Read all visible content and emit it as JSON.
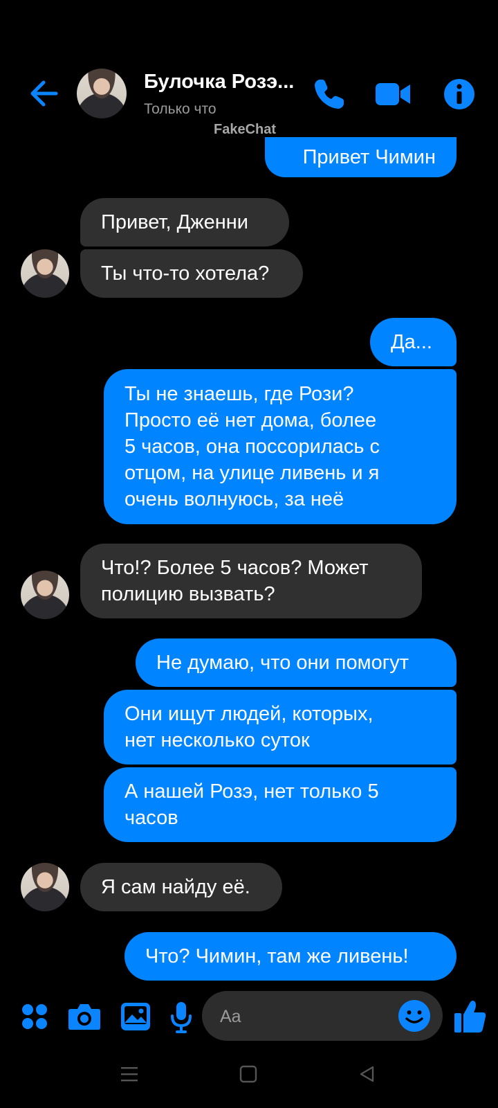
{
  "header": {
    "contact_name": "Булочка Розэ...",
    "status": "Только что",
    "watermark": "FakeChat"
  },
  "messages": [
    {
      "sender": "me",
      "text": "Привет Чимин"
    },
    {
      "sender": "contact",
      "text": "Привет, Дженни"
    },
    {
      "sender": "contact",
      "text": "Ты что-то хотела?"
    },
    {
      "sender": "me",
      "text": "Да..."
    },
    {
      "sender": "me",
      "text": "Ты не знаешь, где Рози?\nПросто её нет дома, более\n5 часов, она поссорилась с\nотцом, на улице ливень и я\nочень волнуюсь, за неё"
    },
    {
      "sender": "contact",
      "text": "Что!? Более 5 часов? Может\nполицию вызвать?"
    },
    {
      "sender": "me",
      "text": "Не думаю, что они помогут"
    },
    {
      "sender": "me",
      "text": "Они ищут людей, которых,\nнет несколько суток"
    },
    {
      "sender": "me",
      "text": "А нашей Розэ, нет только 5\nчасов"
    },
    {
      "sender": "contact",
      "text": "Я сам найду её."
    },
    {
      "sender": "me",
      "text": "Что? Чимин, там же ливень!"
    }
  ],
  "composer": {
    "placeholder": "Aa"
  },
  "icons": {
    "back": "arrow-left-icon",
    "call": "phone-icon",
    "video": "video-camera-icon",
    "info": "info-icon",
    "apps": "four-dots-icon",
    "camera": "camera-icon",
    "gallery": "image-icon",
    "voice": "microphone-icon",
    "emoji": "smiley-icon",
    "like": "thumbs-up-icon"
  },
  "colors": {
    "accent": "#0084ff",
    "incoming_bubble": "#303030",
    "background": "#000000"
  }
}
